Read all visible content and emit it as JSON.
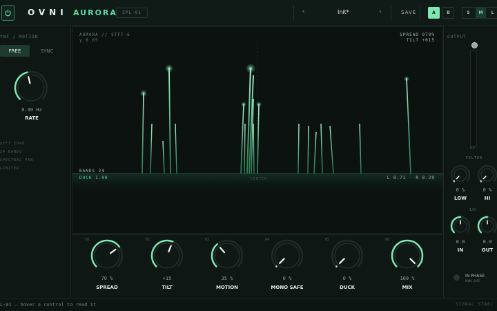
{
  "header": {
    "brand": "OVNI",
    "product": "AURORA",
    "model_badge": "SPL-01",
    "preset_prev": "‹",
    "preset_name": "Init*",
    "preset_next": "›",
    "save_label": "SAVE",
    "ab": [
      "A",
      "B"
    ],
    "ab_active": "A",
    "modes": [
      "S",
      "M",
      "L"
    ],
    "mode_active": "M"
  },
  "left_panel": {
    "title": "YNC / MOTION",
    "tabs": [
      "FREE",
      "SYNC"
    ],
    "active_tab": "FREE",
    "rate": {
      "value": "0.30 Hz",
      "label": "RATE",
      "level": 0.45
    },
    "info": [
      "STFT 2048",
      "24 BANDS",
      "SPECTRAL PAN",
      "LIMITER"
    ]
  },
  "spectrum": {
    "top_left_1": "AURORA // STFT-6",
    "top_left_2": "γ 0.65",
    "top_right_1": "SPREAD 070%",
    "top_right_2": "TILT +015",
    "bottom_left_1": "BANDS 24",
    "bottom_left_2": "DUCK 1.00",
    "center_label": "CENTER",
    "bottom_right": "L 0.71 · R 0.29"
  },
  "knobs": [
    {
      "index": "01",
      "value": "70 %",
      "label": "SPREAD",
      "level": 0.7
    },
    {
      "index": "02",
      "value": "+15",
      "label": "TILT",
      "level": 0.58
    },
    {
      "index": "03",
      "value": "35 %",
      "label": "MOTION",
      "level": 0.35
    },
    {
      "index": "04",
      "value": "0 %",
      "label": "MONO SAFE",
      "level": 0.0
    },
    {
      "index": "05",
      "value": "0 %",
      "label": "DUCK",
      "level": 0.0
    },
    {
      "index": "06",
      "value": "100 %",
      "label": "MIX",
      "level": 1.0
    }
  ],
  "right_panel": {
    "output_title": "OUTPUT",
    "meter_label": "OUT",
    "filter_title": "FILTER",
    "filter": [
      {
        "value": "0 %",
        "label": "LOW",
        "level": 0.0
      },
      {
        "value": "0 %",
        "label": "HI",
        "level": 0.0
      }
    ],
    "io_title": "I/O",
    "io": [
      {
        "value": "0.0",
        "label": "IN",
        "level": 0.5
      },
      {
        "value": "0.0",
        "label": "OUT",
        "level": 0.5
      }
    ],
    "inphase_label": "IN PHASE",
    "inphase_sub": "MONO SAFE"
  },
  "status": {
    "message": "L-01  —  hover a control to read it",
    "right": "SIGNAL STABL"
  },
  "colors": {
    "accent": "#7de8b1",
    "accent_dim": "#2f8a65",
    "bg": "#0c1412"
  }
}
